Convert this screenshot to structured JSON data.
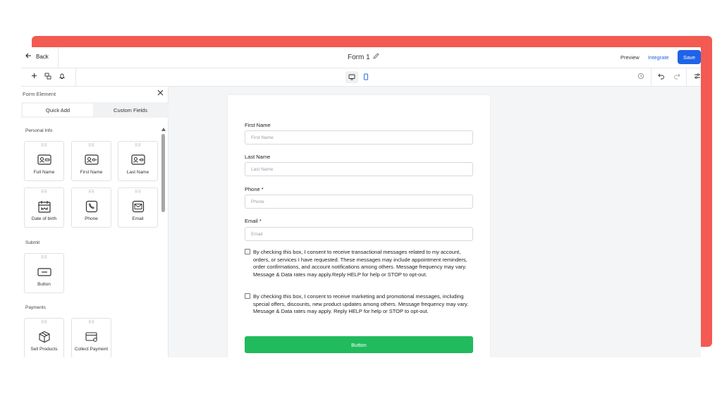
{
  "header": {
    "back_label": "Back",
    "form_title": "Form 1",
    "preview_label": "Preview",
    "integrate_label": "Integrate",
    "save_label": "Save"
  },
  "toolbar": {
    "left_icons": [
      "plus-icon",
      "layers-icon",
      "bell-icon"
    ],
    "devices": [
      "desktop-icon",
      "mobile-icon"
    ],
    "active_device": "mobile",
    "right_icons": [
      "history-icon",
      "undo-icon",
      "redo-icon",
      "settings-icon"
    ]
  },
  "sidebar": {
    "title": "Form Element",
    "tabs": [
      {
        "label": "Quick Add"
      },
      {
        "label": "Custom Fields"
      }
    ],
    "active_tab": "Quick Add",
    "sections": [
      {
        "label": "Personal Info",
        "items": [
          {
            "label": "Full Name",
            "icon": "id-card-icon"
          },
          {
            "label": "First Name",
            "icon": "id-card-icon"
          },
          {
            "label": "Last Name",
            "icon": "id-card-icon"
          },
          {
            "label": "Date of birth",
            "icon": "calendar-icon"
          },
          {
            "label": "Phone",
            "icon": "phone-icon"
          },
          {
            "label": "Email",
            "icon": "mail-icon"
          }
        ]
      },
      {
        "label": "Submit",
        "items": [
          {
            "label": "Button",
            "icon": "button-icon"
          }
        ]
      },
      {
        "label": "Payments",
        "items": [
          {
            "label": "Sell Products",
            "icon": "box-icon"
          },
          {
            "label": "Collect Payment",
            "icon": "credit-card-icon"
          }
        ]
      }
    ]
  },
  "form": {
    "fields": [
      {
        "label": "First Name",
        "placeholder": "First Name"
      },
      {
        "label": "Last Name",
        "placeholder": "Last Name"
      },
      {
        "label": "Phone *",
        "placeholder": "Phone"
      },
      {
        "label": "Email *",
        "placeholder": "Email"
      }
    ],
    "consents": [
      "By checking this box, I consent to receive transactional messages related to my account, orders, or services I have requested. These messages may include appointment reminders, order confirmations, and account notifications among others. Message frequency may vary. Message & Data rates may apply.Reply HELP for help or STOP to opt-out.",
      "By checking this box, I consent to receive marketing and promotional messages, including special offers, discounts, new product updates among others. Message frequency may vary. Message & Data rates may apply. Reply HELP for help or STOP to opt-out."
    ],
    "submit_label": "Button"
  },
  "colors": {
    "accent_background": "#f25a52",
    "primary": "#1f63e8",
    "submit_button": "#21bb5d"
  }
}
